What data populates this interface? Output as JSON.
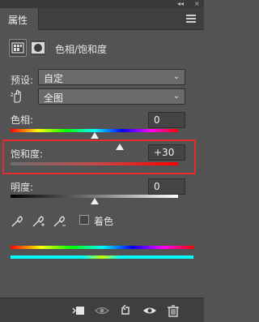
{
  "panel": {
    "tab_label": "属性",
    "collapse_glyph": "◂◂",
    "close_glyph": "×",
    "adjustment_title": "色相/饱和度"
  },
  "preset": {
    "label": "预设:",
    "value": "自定"
  },
  "channel": {
    "value": "全图"
  },
  "hue": {
    "label": "色相:",
    "value": "0",
    "slider_fraction": 0.5
  },
  "saturation": {
    "label": "饱和度:",
    "value": "+30",
    "slider_fraction": 0.65
  },
  "lightness": {
    "label": "明度:",
    "value": "0",
    "slider_fraction": 0.5
  },
  "colorize": {
    "label": "着色",
    "checked": false
  },
  "colors": {
    "highlight": "#e52b2b"
  },
  "icons": [
    "mask-clip-icon",
    "visibility-toggle-icon",
    "reset-icon",
    "eye-icon",
    "trash-icon",
    "eyedropper-icon",
    "eyedropper-add-icon",
    "eyedropper-subtract-icon",
    "hand-target-icon"
  ]
}
